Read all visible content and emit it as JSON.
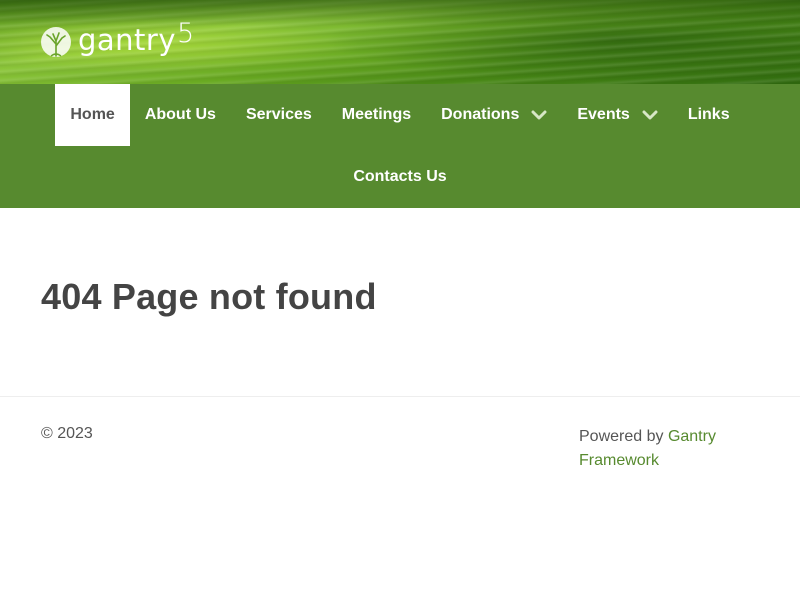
{
  "header": {
    "logo_text": "gantry",
    "logo_sup": "5"
  },
  "nav": {
    "items": [
      {
        "label": "Home",
        "active": true
      },
      {
        "label": "About Us"
      },
      {
        "label": "Services"
      },
      {
        "label": "Meetings"
      },
      {
        "label": "Donations",
        "dropdown": true
      },
      {
        "label": "Events",
        "dropdown": true
      },
      {
        "label": "Links"
      },
      {
        "label": "Contacts Us"
      }
    ]
  },
  "main": {
    "title": "404 Page not found"
  },
  "footer": {
    "copyright": "© 2023",
    "powered_prefix": "Powered by ",
    "powered_link_1": "Gantry",
    "powered_link_2": "Framework"
  },
  "colors": {
    "nav_bg": "#578a2f",
    "link": "#578a2f",
    "text": "#444444"
  }
}
